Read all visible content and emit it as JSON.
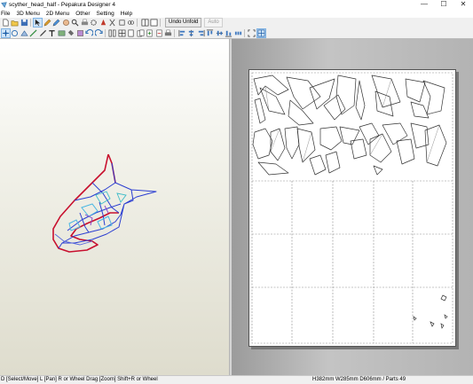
{
  "window": {
    "title": "scyther_head_half - Pepakura Designer 4",
    "controls": [
      "—",
      "☐",
      "✕"
    ]
  },
  "menu": [
    "File",
    "3D Menu",
    "2D Menu",
    "Other",
    "Setting",
    "Help"
  ],
  "toolbar1": {
    "icons": [
      "new-icon",
      "open-icon",
      "save-icon",
      "select-icon",
      "edit-icon",
      "edit2-icon",
      "hand-icon",
      "zoom-icon",
      "print-icon",
      "settings-icon",
      "color-icon",
      "scissors-icon",
      "rotate-icon",
      "link-icon",
      "split-view-icon",
      "window-icon"
    ],
    "undo_unfold": "Undo Unfold",
    "auto": "Auto"
  },
  "toolbar2": {
    "icons": [
      "move-icon",
      "rotate3d-icon",
      "join-icon",
      "draw-line-icon",
      "edit-line-icon",
      "text-icon",
      "image-icon",
      "fill-icon",
      "texture-icon",
      "undo-icon",
      "redo-icon",
      "columns-icon",
      "grid-icon",
      "page-icon",
      "pages-icon",
      "page-add-icon",
      "page-remove-icon",
      "printer-icon",
      "align-left-icon",
      "align-center-icon",
      "align-right-icon",
      "align-top-icon",
      "align-middle-icon",
      "align-bottom-icon",
      "distribute-icon",
      "fit-icon",
      "snap-icon"
    ]
  },
  "status": {
    "left": "D [Select/Move] L [Pan] R or Wheel Drag [Zoom] Shift+R or Wheel",
    "right": "H382mm W285mm D606mm / Parts 49"
  }
}
